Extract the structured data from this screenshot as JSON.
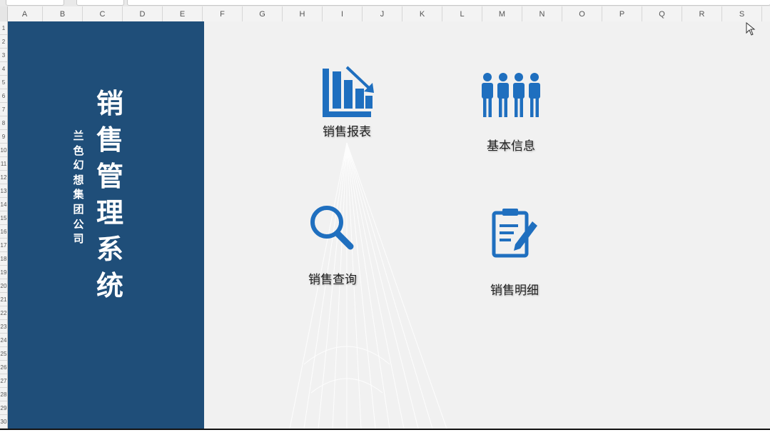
{
  "sheet": {
    "columns": [
      "A",
      "B",
      "C",
      "D",
      "E",
      "F",
      "G",
      "H",
      "I",
      "J",
      "K",
      "L",
      "M",
      "N",
      "O",
      "P",
      "Q",
      "R",
      "S"
    ],
    "rows": [
      "1",
      "2",
      "3",
      "4",
      "5",
      "6",
      "7",
      "8",
      "9",
      "10",
      "11",
      "12",
      "13",
      "14",
      "15",
      "16",
      "17",
      "18",
      "19",
      "20",
      "21",
      "22",
      "23",
      "24",
      "25",
      "26",
      "27",
      "28",
      "29",
      "30"
    ]
  },
  "sidebar": {
    "title_chars": [
      "销",
      "售",
      "管",
      "理",
      "系",
      "统"
    ],
    "company_chars": [
      "兰",
      "色",
      "幻",
      "想",
      "集",
      "团",
      "公",
      "司"
    ]
  },
  "menu": {
    "sales_report": "销售报表",
    "basic_info": "基本信息",
    "sales_query": "销售查询",
    "sales_detail": "销售明细"
  },
  "colors": {
    "sidebar_bg": "#1f4e79",
    "icon_blue": "#1f6fbf",
    "main_bg": "#f1f1f1"
  },
  "icons": {
    "sales_report": "bar-chart-down-icon",
    "basic_info": "people-group-icon",
    "sales_query": "magnifier-icon",
    "sales_detail": "clipboard-pen-icon"
  }
}
